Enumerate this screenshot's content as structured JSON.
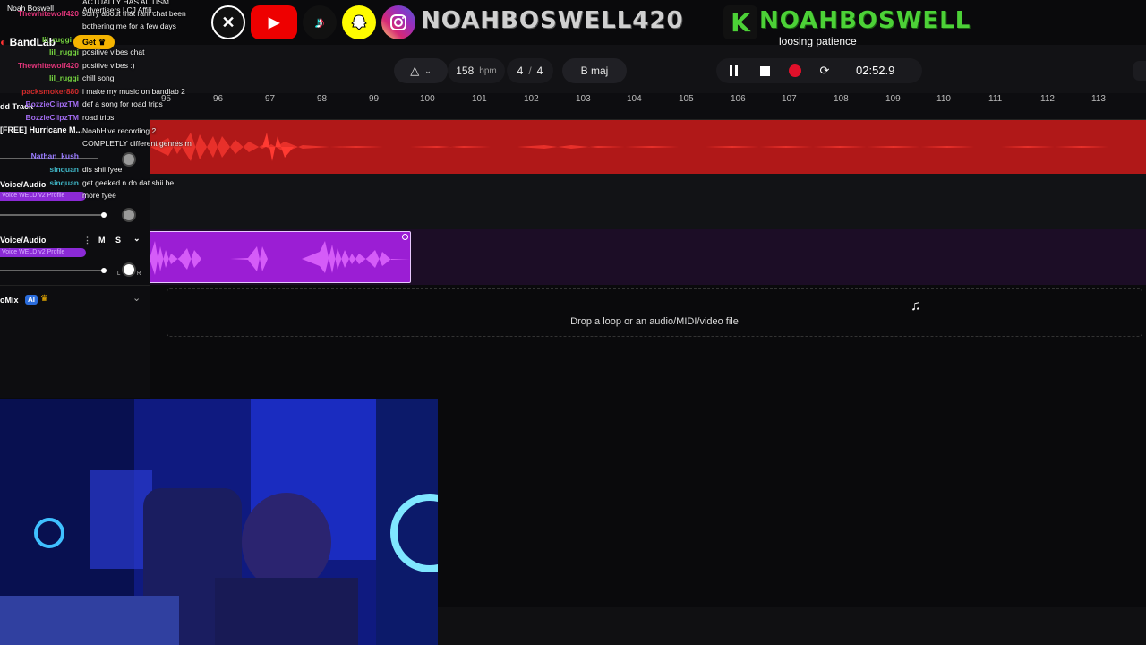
{
  "stream": {
    "streamer_name": "Noah Boswell",
    "status_text": "loosing patience",
    "socials": [
      "X",
      "YouTube",
      "TikTok",
      "Snapchat",
      "Instagram"
    ],
    "handle_primary": "NOAHBOSWELL420",
    "handle_kick_letter": "K",
    "handle_kick": "NOAHBOSWELL"
  },
  "app": {
    "logo": "BandLab",
    "get_label": "Get",
    "tempo": "158",
    "tempo_unit": "bpm",
    "time_sig_num": "4",
    "time_sig_sep": "/",
    "time_sig_den": "4",
    "key": "B maj",
    "time": "02:52.9"
  },
  "ruler": {
    "bars": [
      "95",
      "96",
      "97",
      "98",
      "99",
      "100",
      "101",
      "102",
      "103",
      "104",
      "105",
      "106",
      "107",
      "108",
      "109",
      "110",
      "111",
      "112",
      "113"
    ]
  },
  "left_panel": {
    "add_track": "dd Track",
    "track1_name": "[FREE] Hurricane M...",
    "track2_name": "Voice/Audio",
    "track2_badge": "Voice WELD v2 Profile",
    "track3_name": "Voice/Audio",
    "track3_badge": "Voice WELD v2 Profile",
    "mute_label": "M",
    "solo_label": "S",
    "automix_label": "oMix",
    "ai_badge": "AI",
    "knob_l": "L",
    "knob_r": "R"
  },
  "drop_zone": {
    "text": "Drop a loop or an audio/MIDI/video file"
  },
  "chat": [
    {
      "user": "",
      "msg": "ACTUALLY HAS AUTISM",
      "color": "#ffffff"
    },
    {
      "user": "",
      "msg": "Advertisers | CJ Affili...",
      "color": "#ffffff"
    },
    {
      "user": "Thewhitewolf420",
      "msg": "sorry about that rant chat been",
      "color": "#e0357a"
    },
    {
      "user": "",
      "msg": "bothering me for a few days",
      "color": "#ffffff"
    },
    {
      "user": "lil_ruggi",
      "msg": "",
      "color": "#76d640"
    },
    {
      "user": "lil_ruggi",
      "msg": "positive vibes chat",
      "color": "#76d640"
    },
    {
      "user": "Thewhitewolf420",
      "msg": "positive vibes :)",
      "color": "#e0357a"
    },
    {
      "user": "lil_ruggi",
      "msg": "chill song",
      "color": "#76d640"
    },
    {
      "user": "packsmoker880",
      "msg": "i make my music on bandlab 2",
      "color": "#d02a2a"
    },
    {
      "user": "BozzieClipzTM",
      "msg": "def a song for road trips",
      "color": "#a26cf0"
    },
    {
      "user": "BozzieClipzTM",
      "msg": "road trips",
      "color": "#a26cf0"
    },
    {
      "user": "",
      "msg": "NoahHive recording 2",
      "color": "#ffffff"
    },
    {
      "user": "",
      "msg": "COMPLETLY different genres rn",
      "color": "#ffffff"
    },
    {
      "user": "Nathan_kush",
      "msg": "",
      "color": "#9a7cff"
    },
    {
      "user": "sinquan",
      "msg": "dis shii fyee",
      "color": "#3fb5c5"
    },
    {
      "user": "sinquan",
      "msg": "get geeked n do dat shii be",
      "color": "#3fb5c5"
    },
    {
      "user": "",
      "msg": "more fyee",
      "color": "#ffffff"
    }
  ],
  "colors": {
    "track_red": "#c81e1e",
    "track_purple": "#9b1ed4",
    "record": "#e0102a",
    "handle_green": "#4cd137"
  }
}
